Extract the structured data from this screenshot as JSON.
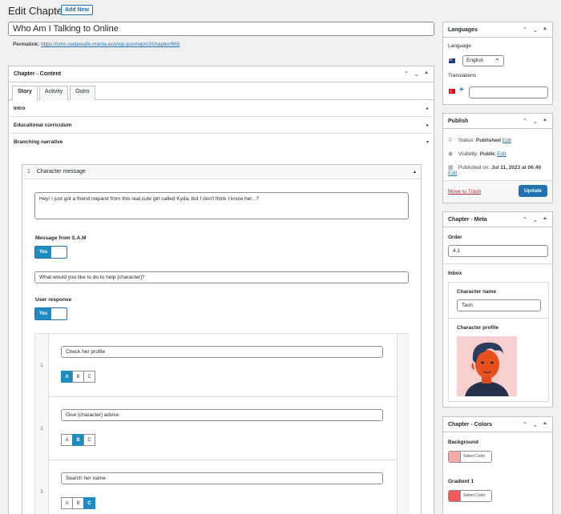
{
  "page": {
    "heading": "Edit Chapter",
    "add_new": "Add New",
    "title": "Who Am I Talking to Online",
    "permalink_label": "Permalink:",
    "permalink_url": "https://cms.swipesafe.manta.eco/wp-json/wp/v2/chapter/665"
  },
  "content_box": {
    "title": "Chapter - Content",
    "tabs": [
      "Story",
      "Activity",
      "Outro"
    ],
    "sections": [
      {
        "label": "Intro",
        "arrow": "▸"
      },
      {
        "label": "Educational curriculum",
        "arrow": "▸"
      },
      {
        "label": "Branching narrative",
        "arrow": "▾"
      }
    ],
    "block": {
      "number": "1",
      "title": "Character message",
      "message": "Hey! I just got a friend request from this real cute girl called Kyda, but I don't think I know her...?",
      "sam_label": "Message from S.A.M",
      "toggle_yes": "Yes",
      "question": "What would you like to do to help [character]?",
      "user_response_label": "User response",
      "responses": [
        {
          "num": "1",
          "text": "Check her profile",
          "selected": "A"
        },
        {
          "num": "2",
          "text": "Give [character] advice",
          "selected": "B"
        },
        {
          "num": "3",
          "text": "Search her name",
          "selected": "C"
        }
      ],
      "options": [
        "A",
        "B",
        "C"
      ]
    }
  },
  "languages": {
    "title": "Languages",
    "language_label": "Language",
    "language_value": "English",
    "translations_label": "Translations",
    "plus": "+"
  },
  "publish": {
    "title": "Publish",
    "status_label": "Status:",
    "status_value": "Published",
    "visibility_label": "Visibility:",
    "visibility_value": "Public",
    "published_label": "Published on:",
    "published_value": "Jul 11, 2023 at 06:40",
    "edit": "Edit",
    "trash": "Move to Trash",
    "update": "Update"
  },
  "meta": {
    "title": "Chapter - Meta",
    "order_label": "Order",
    "order_value": "4.1",
    "inbox_label": "Inbox",
    "character_name_label": "Character name",
    "character_name_value": "Tash",
    "character_profile_label": "Character profile"
  },
  "colors": {
    "title": "Chapter - Colors",
    "background_label": "Background",
    "gradient_label": "Gradient 1",
    "select_color": "Select Color",
    "background_color": "#f7a8a8",
    "gradient_color": "#f25a5a"
  },
  "ctrl_icons": [
    "chevron-up",
    "chevron-down",
    "triangle-up"
  ]
}
